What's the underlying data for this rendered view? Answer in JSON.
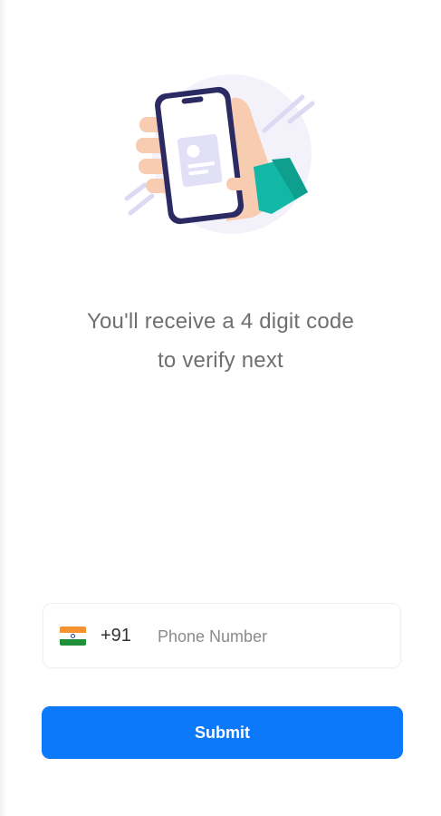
{
  "illustration": {
    "icon": "hand-holding-phone-icon",
    "colors": {
      "background": "#f3f2fb",
      "phone_frame": "#2c2a63",
      "screen": "#ffffff",
      "card": "#e2e0f7",
      "skin": "#f7ccb0",
      "sleeve": "#12b8a5",
      "accent_lines": "#dcdaf3"
    }
  },
  "message": {
    "line1": "You'll receive a 4 digit code",
    "line2": "to verify next"
  },
  "phone_field": {
    "flag_icon": "india-flag-icon",
    "country_code": "+91",
    "placeholder": "Phone Number",
    "value": ""
  },
  "submit": {
    "label": "Submit",
    "color": "#0c79fb"
  }
}
